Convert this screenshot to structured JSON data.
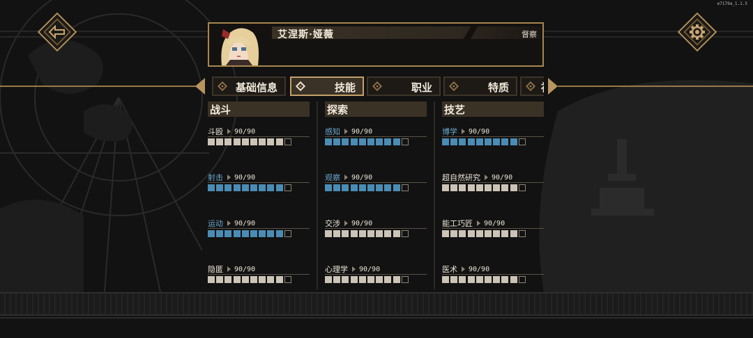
{
  "version": "e7179a_1.1.5",
  "character": {
    "name": "艾涅斯·娅薇",
    "occupation": "督察"
  },
  "tabs": [
    {
      "label": "基础信息",
      "active": false
    },
    {
      "label": "技能",
      "active": true
    },
    {
      "label": "职业",
      "active": false
    },
    {
      "label": "特质",
      "active": false
    },
    {
      "label": "社",
      "active": false
    }
  ],
  "icons": {
    "back": "back-arrow-icon",
    "settings": "gear-icon",
    "tab_prev": "arrow-left-icon",
    "tab_next": "arrow-right-icon"
  },
  "colors": {
    "gold": "#b08d5a",
    "header_bg": "#3b3226",
    "pip_filled": "#cbc4b7",
    "pip_boosted": "#4a8cb4",
    "boosted_label": "#6aa6cc"
  },
  "skill_columns": [
    {
      "title": "战斗",
      "skills": [
        {
          "name": "斗殴",
          "value": "90/90",
          "filled": 9,
          "total": 10,
          "boosted": false
        },
        {
          "name": "射击",
          "value": "90/90",
          "filled": 9,
          "total": 10,
          "boosted": true
        },
        {
          "name": "运动",
          "value": "90/90",
          "filled": 9,
          "total": 10,
          "boosted": true
        },
        {
          "name": "隐匿",
          "value": "90/90",
          "filled": 9,
          "total": 10,
          "boosted": false
        }
      ]
    },
    {
      "title": "探索",
      "skills": [
        {
          "name": "感知",
          "value": "90/90",
          "filled": 9,
          "total": 10,
          "boosted": true
        },
        {
          "name": "观察",
          "value": "90/90",
          "filled": 9,
          "total": 10,
          "boosted": true
        },
        {
          "name": "交涉",
          "value": "90/90",
          "filled": 9,
          "total": 10,
          "boosted": false
        },
        {
          "name": "心理学",
          "value": "90/90",
          "filled": 9,
          "total": 10,
          "boosted": false
        }
      ]
    },
    {
      "title": "技艺",
      "skills": [
        {
          "name": "博学",
          "value": "90/90",
          "filled": 9,
          "total": 10,
          "boosted": true
        },
        {
          "name": "超自然研究",
          "value": "90/90",
          "filled": 9,
          "total": 10,
          "boosted": false
        },
        {
          "name": "能工巧匠",
          "value": "90/90",
          "filled": 9,
          "total": 10,
          "boosted": false
        },
        {
          "name": "医术",
          "value": "90/90",
          "filled": 9,
          "total": 10,
          "boosted": false
        }
      ]
    }
  ]
}
